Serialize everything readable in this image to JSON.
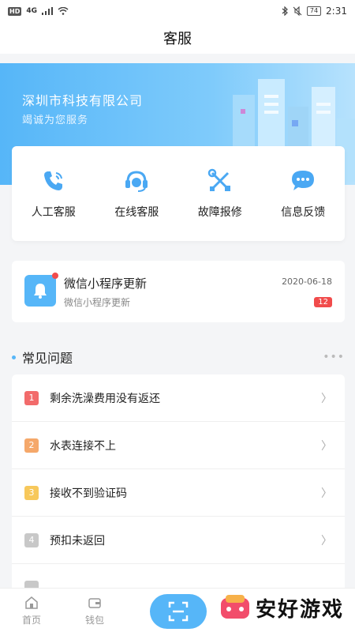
{
  "status_bar": {
    "hd": "HD",
    "signal": "4G",
    "battery": "74",
    "time": "2:31"
  },
  "header": {
    "title": "客服"
  },
  "banner": {
    "company": "深圳市科技有限公司",
    "slogan": "竭诚为您服务",
    "accent": "#56b6f8"
  },
  "services": [
    {
      "label": "人工客服",
      "icon": "phone-icon"
    },
    {
      "label": "在线客服",
      "icon": "headset-icon"
    },
    {
      "label": "故障报修",
      "icon": "repair-tools-icon"
    },
    {
      "label": "信息反馈",
      "icon": "chat-bubble-icon"
    }
  ],
  "notice": {
    "title": "微信小程序更新",
    "desc": "微信小程序更新",
    "date": "2020-06-18",
    "count": "12"
  },
  "faq": {
    "title": "常见问题",
    "more": "•••",
    "items": [
      {
        "num": "1",
        "text": "剩余洗澡费用没有返还",
        "color": "#f26b6b"
      },
      {
        "num": "2",
        "text": "水表连接不上",
        "color": "#f5a86a"
      },
      {
        "num": "3",
        "text": "接收不到验证码",
        "color": "#f7c85b"
      },
      {
        "num": "4",
        "text": "预扣未返回",
        "color": "#c8c8c8"
      }
    ]
  },
  "tabs": {
    "home": "首页",
    "wallet": "钱包"
  },
  "watermark": {
    "text": "安好游戏"
  }
}
